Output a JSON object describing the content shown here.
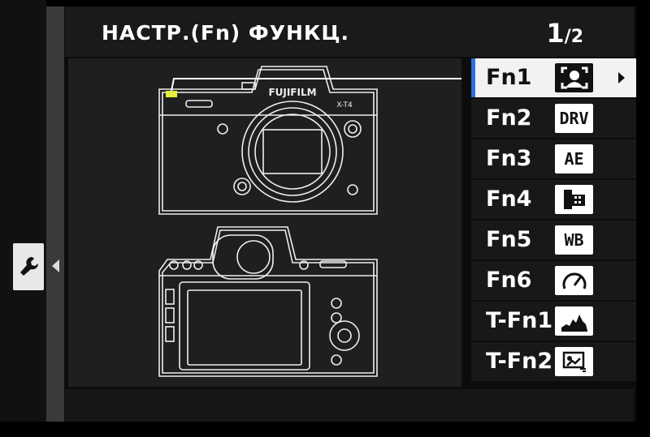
{
  "header": {
    "title": "НАСТР.(Fn) ФУНКЦ.",
    "page_current": "1",
    "page_total": "/2"
  },
  "camera": {
    "brand": "FUJIFILM",
    "model": "X-T4"
  },
  "fn_list": [
    {
      "label": "Fn1",
      "icon": "face-detect-icon",
      "selected": true
    },
    {
      "label": "Fn2",
      "icon": "drive-mode-icon",
      "icon_text": "DRV"
    },
    {
      "label": "Fn3",
      "icon": "ae-icon",
      "icon_text": "AE"
    },
    {
      "label": "Fn4",
      "icon": "film-simulation-icon"
    },
    {
      "label": "Fn5",
      "icon": "white-balance-icon",
      "icon_text": "WB"
    },
    {
      "label": "Fn6",
      "icon": "performance-icon"
    },
    {
      "label": "T-Fn1",
      "icon": "histogram-icon"
    },
    {
      "label": "T-Fn2",
      "icon": "image-quality-icon"
    }
  ],
  "colors": {
    "accent": "#2b6fe0",
    "highlight_button": "#e5f03a"
  }
}
